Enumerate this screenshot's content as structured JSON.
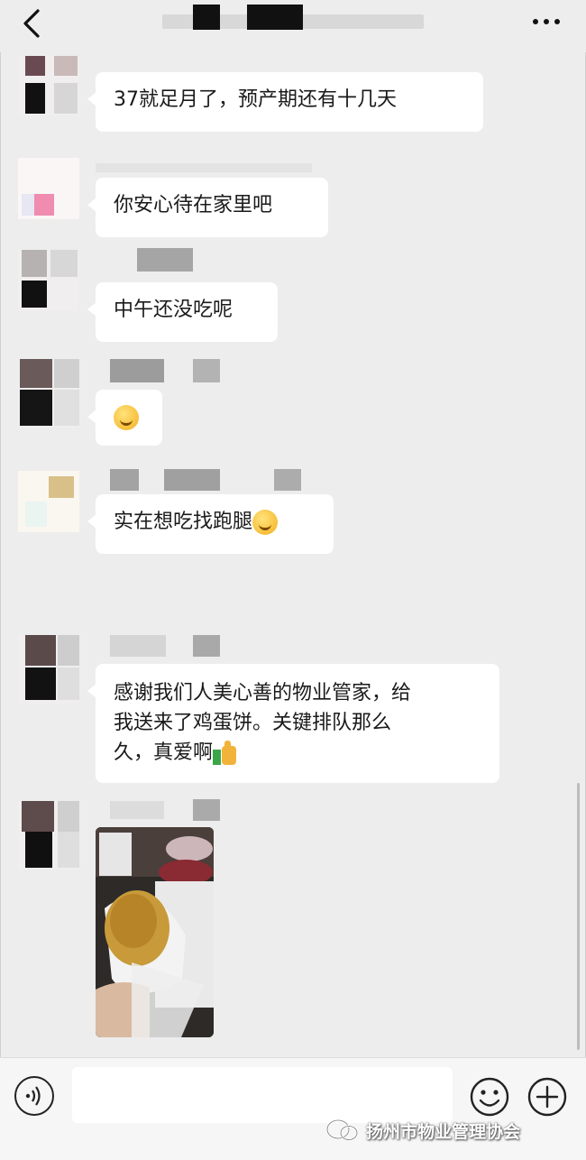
{
  "topbar": {
    "back_icon": "chevron-left-icon",
    "more_icon": "ellipsis-icon"
  },
  "messages": [
    {
      "text": "37就足月了，预产期还有十几天"
    },
    {
      "text": "你安心待在家里吧"
    },
    {
      "text": "中午还没吃呢"
    },
    {
      "text": "",
      "emoji": "sweat-smile-emoji"
    },
    {
      "text": "实在想吃找跑腿",
      "emoji": "sweat-smile-emoji"
    },
    {
      "lines": [
        "感谢我们人美心善的物业管家，给",
        "我送来了鸡蛋饼。关键排队那么",
        "久，真爱啊"
      ],
      "emoji": "thumbs-up-emoji"
    },
    {
      "image": "egg-pancake-photo"
    }
  ],
  "inputbar": {
    "voice_icon": "voice-icon",
    "input_value": "",
    "emoji_icon": "smiley-icon",
    "plus_icon": "plus-circle-icon"
  },
  "watermark": {
    "text": "扬州市物业管理协会",
    "icon": "wechat-official-icon"
  },
  "colors": {
    "background": "#ededed",
    "bubble": "#ffffff",
    "text": "#1a1a1a"
  }
}
